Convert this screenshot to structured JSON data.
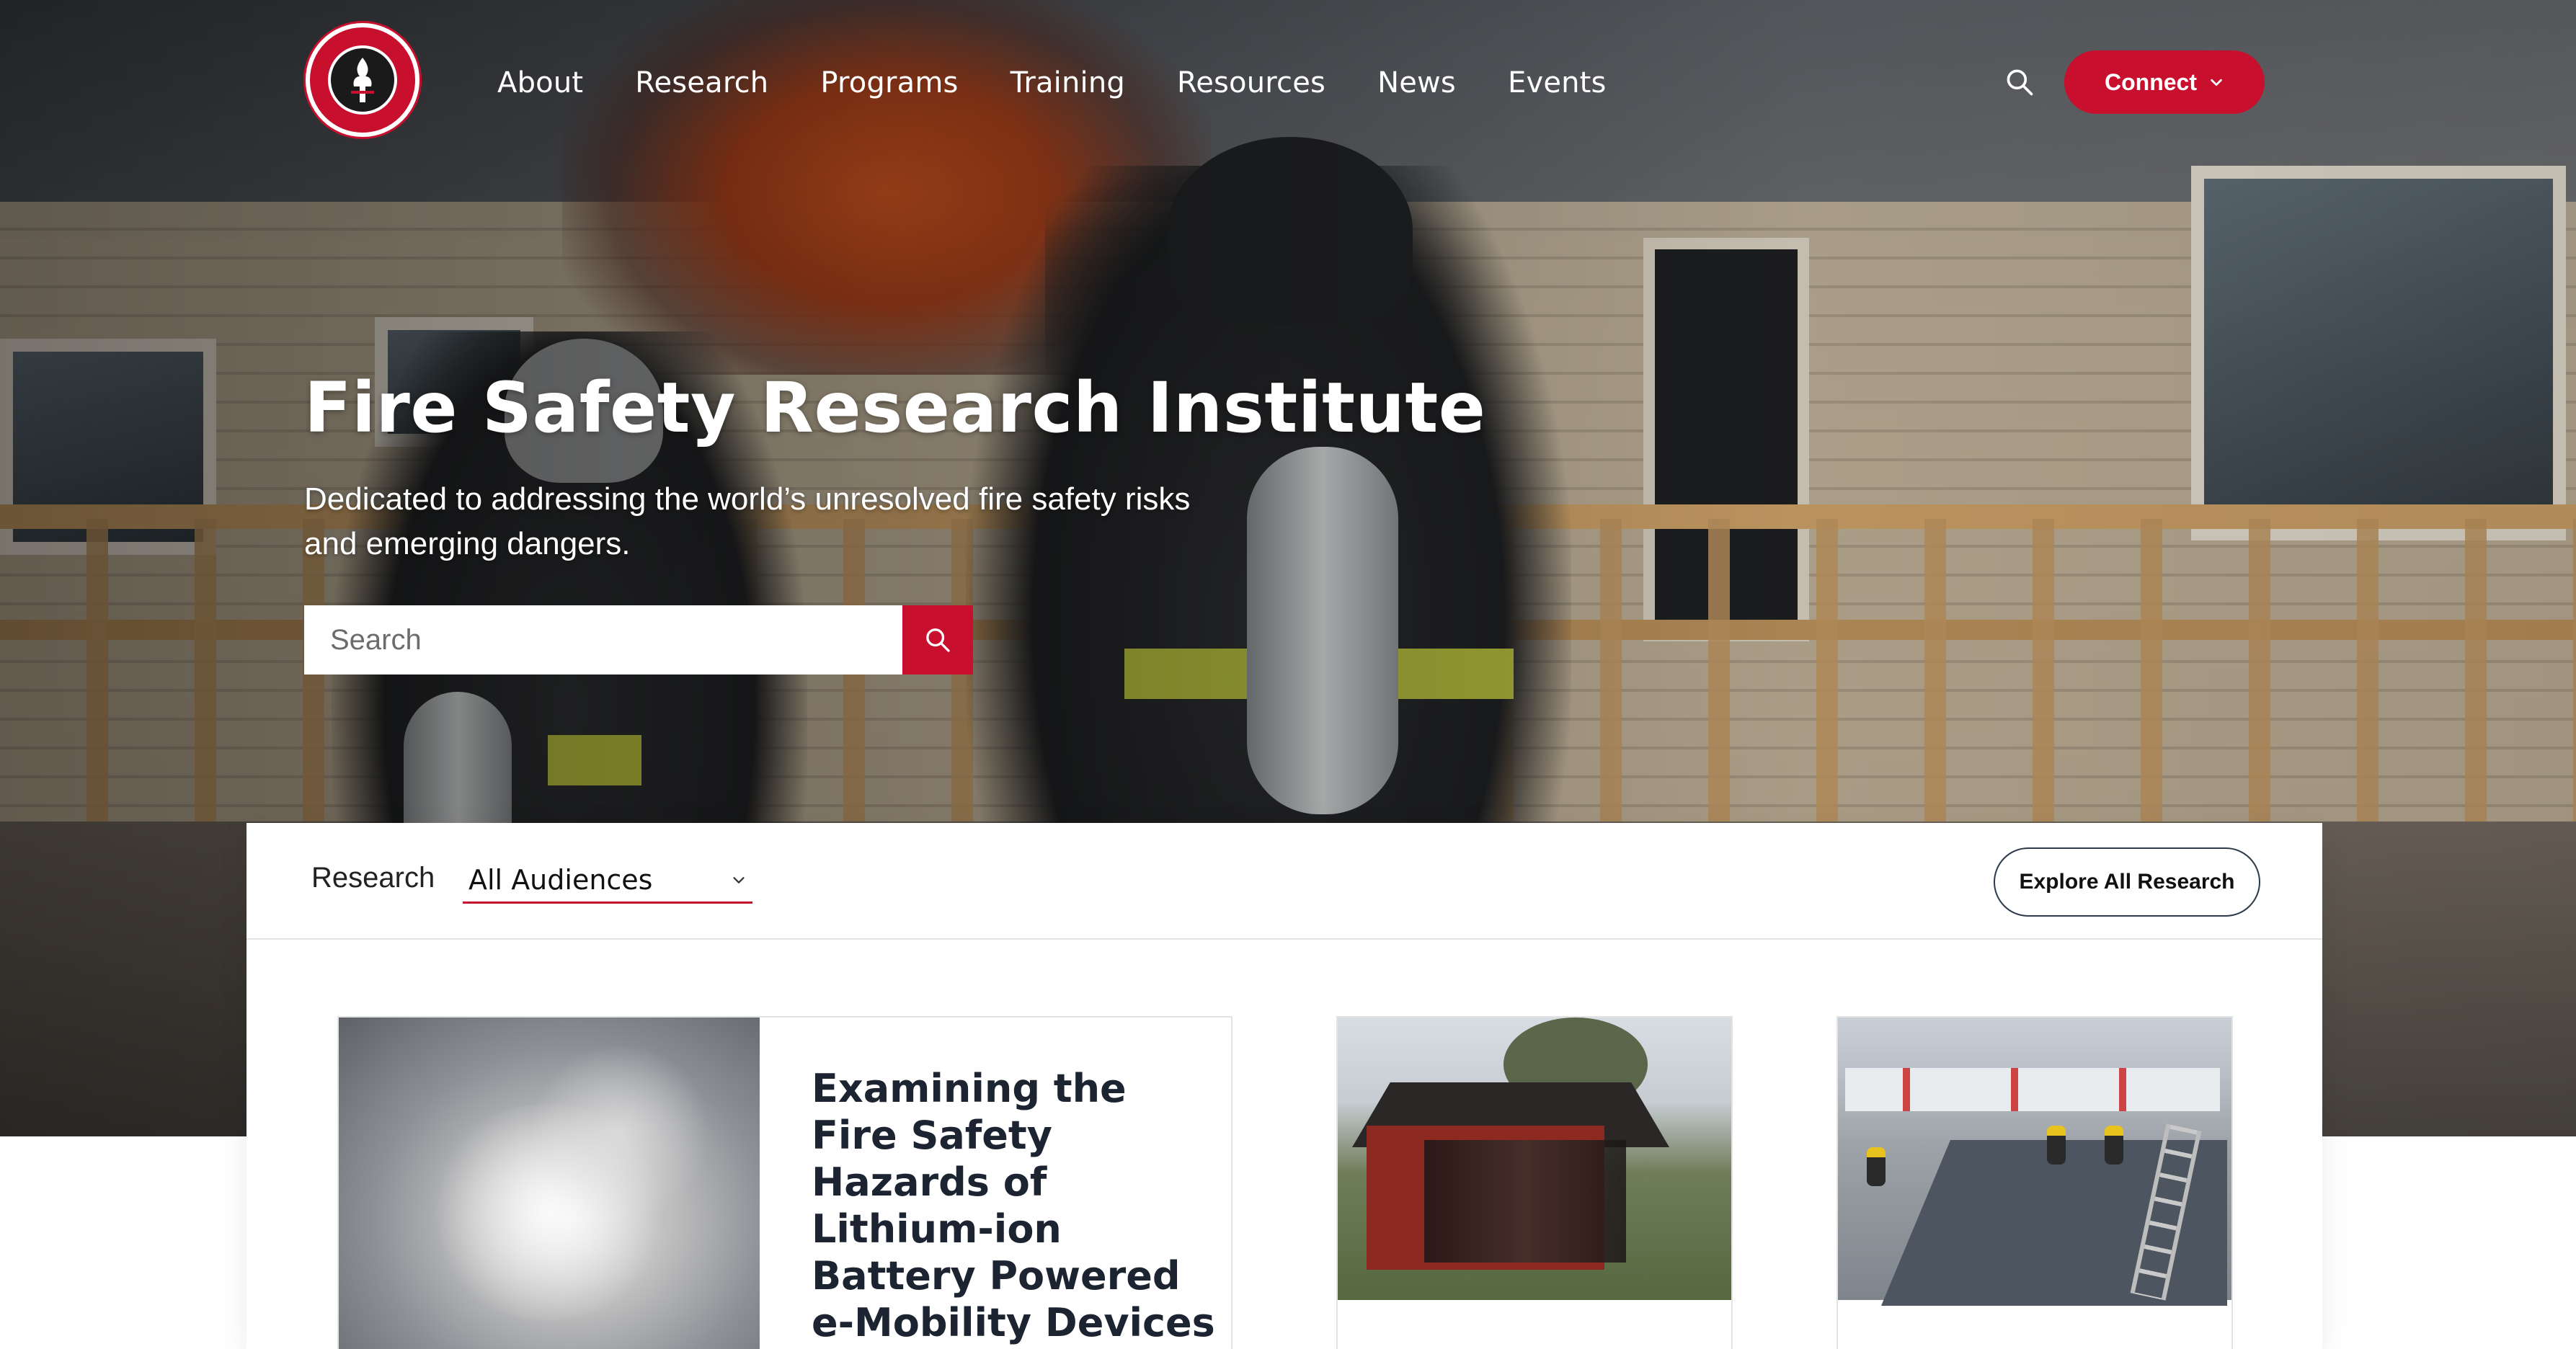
{
  "site": {
    "logo_alt": "Fire Safety Research Institute"
  },
  "nav": {
    "items": [
      {
        "label": "About"
      },
      {
        "label": "Research"
      },
      {
        "label": "Programs"
      },
      {
        "label": "Training"
      },
      {
        "label": "Resources"
      },
      {
        "label": "News"
      },
      {
        "label": "Events"
      }
    ],
    "connect_label": "Connect"
  },
  "hero": {
    "title": "Fire Safety Research Institute",
    "subtitle": "Dedicated to addressing the world’s unresolved fire safety risks and emerging dangers.",
    "search_placeholder": "Search"
  },
  "research": {
    "label": "Research",
    "audience_selected": "All Audiences",
    "explore_label": "Explore All Research",
    "featured_title": "Examining the Fire Safety Hazards of Lithium-ion Battery Powered e-Mobility Devices in Homes"
  },
  "colors": {
    "brand_red": "#c8102e",
    "text_dark": "#1b2430"
  },
  "icons": {
    "top_search": "search-icon",
    "hero_search": "search-icon",
    "connect_chevron": "chevron-down-icon",
    "select_chevron": "chevron-down-icon"
  }
}
